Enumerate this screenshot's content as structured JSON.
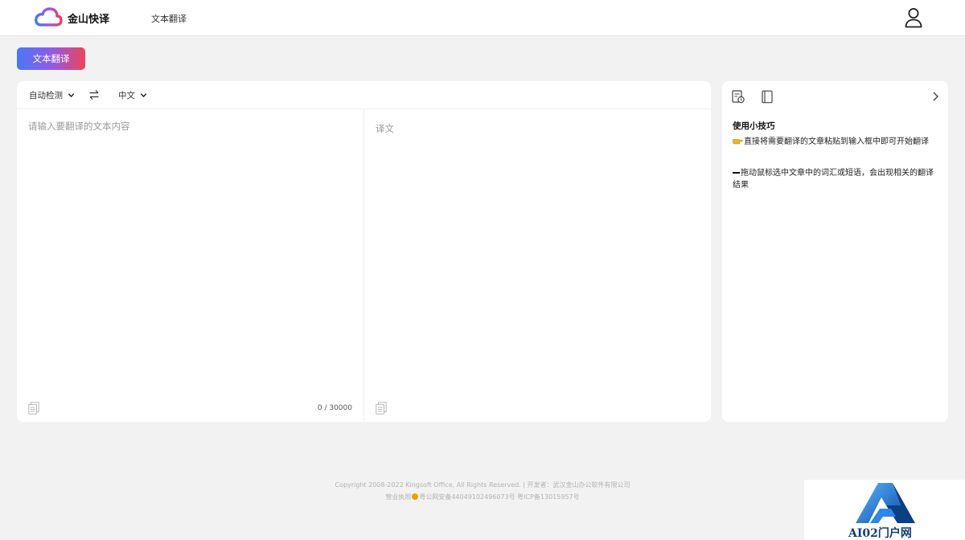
{
  "header": {
    "brand_name": "金山快译",
    "nav_link": "文本翻译",
    "brand_colors": [
      "#3f7cf4",
      "#9b58e6",
      "#ee4057"
    ]
  },
  "mode_button": {
    "label": "文本翻译"
  },
  "translator": {
    "source_language": "自动检测",
    "target_language": "中文",
    "source_placeholder": "请输入要翻译的文本内容",
    "target_placeholder": "译文",
    "char_count": "0 / 30000"
  },
  "tips": {
    "title": "使用小技巧",
    "items": [
      "直接将需要翻译的文章粘贴到输入框中即可开始翻译",
      "拖动鼠标选中文章中的词汇或短语，会出现相关的翻译结果"
    ]
  },
  "footer": {
    "line1": "Copyright 2008-2022 Kingsoft Office, All Rights Reserved. | 开发者：武汉金山办公软件有限公司",
    "line2_prefix": "营业执照",
    "line2_suffix": "粤公网安备44049102496073号 粤ICP备13015957号"
  },
  "watermark": {
    "text": "AI02门户网"
  },
  "icons": {
    "brand": "cloud-logo-icon",
    "user": "user-icon",
    "swap": "swap-icon",
    "chevron": "chevron-down-icon",
    "copy": "copy-icon",
    "history": "history-icon",
    "book": "book-icon",
    "collapse": "chevron-right-icon"
  }
}
